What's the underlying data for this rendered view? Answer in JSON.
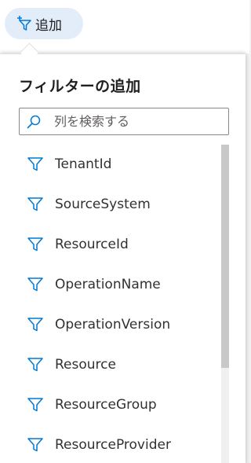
{
  "add_button": {
    "label": "追加",
    "icon": "filter-plus-icon"
  },
  "panel": {
    "title": "フィルターの追加",
    "search": {
      "placeholder": "列を検索する",
      "value": ""
    },
    "items": [
      {
        "label": "TenantId"
      },
      {
        "label": "SourceSystem"
      },
      {
        "label": "ResourceId"
      },
      {
        "label": "OperationName"
      },
      {
        "label": "OperationVersion"
      },
      {
        "label": "Resource"
      },
      {
        "label": "ResourceGroup"
      },
      {
        "label": "ResourceProvider"
      }
    ]
  },
  "colors": {
    "accent": "#0078d4",
    "button_bg": "#e3edf9",
    "text": "#323130"
  }
}
